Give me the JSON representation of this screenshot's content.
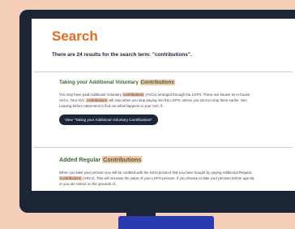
{
  "page": {
    "heading": "Search",
    "summary": "There are 24 results for the search term: \"contributions\"."
  },
  "results": [
    {
      "title_prefix": "Taking your Additional Voluntary ",
      "title_highlight": "Contributions",
      "excerpt": {
        "p1": "You may have paid Additional Voluntary ",
        "h1": "contributions",
        "p2": " (AVCs) arranged through the LGPS. These are known as in-house AVCs. Your AVC ",
        "h2": "contributions",
        "p3": " will stop when you stop paying into the LGPS, unless you elect to stop them earlier. See Leaving before retirement to find out what happens to your AVC if..."
      },
      "button_label": "View \"Taking your Additional Voluntary Contributions\""
    },
    {
      "title_prefix": "Added Regular ",
      "title_highlight": "Contributions",
      "excerpt": {
        "p1": "When you take your pension you will be credited with the extra pension that you have bought by paying Additional Regular ",
        "h1": "Contributions",
        "p2": " (ARCs). This will increase the value of your LGPS pension. If you choose to take your pension before age 65, or you are retired on the grounds of..."
      }
    }
  ],
  "colors": {
    "heading": "#e76a1f",
    "result_title": "#3b6e2f",
    "highlight": "#f6c7ac",
    "button": "#1b2536",
    "background": "#f6cfbb"
  }
}
